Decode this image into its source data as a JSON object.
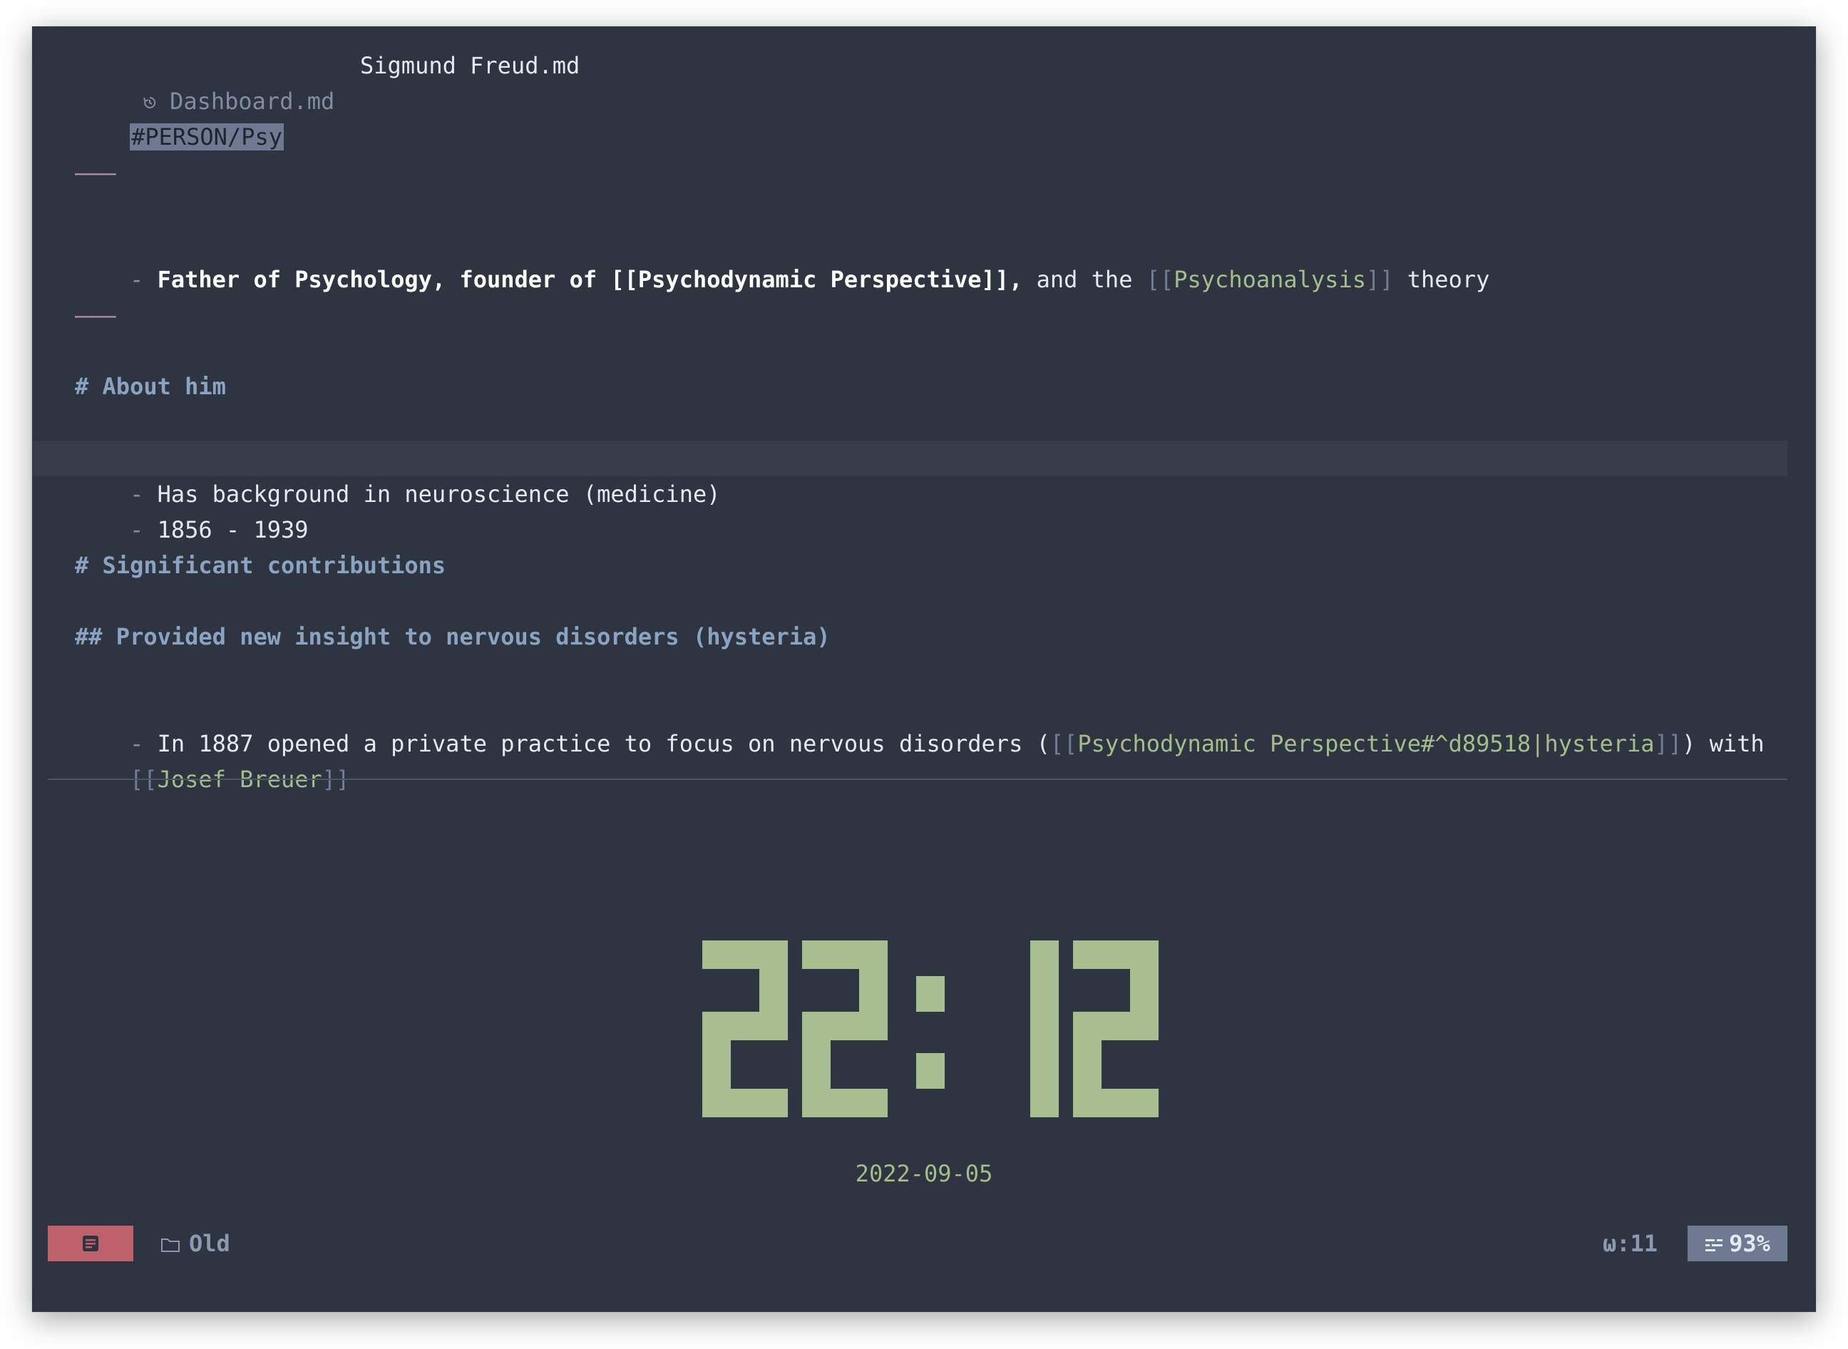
{
  "tabs": [
    {
      "label": "Dashboard.md",
      "icon": "history-icon",
      "active": false
    },
    {
      "label": "Sigmund Freud.md",
      "active": true
    }
  ],
  "note": {
    "tag": "#PERSON/Psy",
    "rule": "———",
    "summary": {
      "bullet": "-",
      "bold_text": "Father of Psychology, founder of [[Psychodynamic Perspective]],",
      "text_1": " and the ",
      "link_open": "[[",
      "link": "Psychoanalysis",
      "link_close": "]]",
      "text_2": " theory"
    },
    "heading_about": "# About him",
    "about_items": [
      "Has background in neuroscience (medicine)",
      "1856 - 1939"
    ],
    "heading_contrib": "# Significant contributions",
    "subheading": "## Provided new insight to nervous disorders (hysteria)",
    "contrib_line": {
      "bullet": "-",
      "text_1": " In 1887 opened a private practice to focus on nervous disorders (",
      "link1_open": "[[",
      "link1": "Psychodynamic Perspective#^d89518|hysteria",
      "link1_close": "]]",
      "text_2": ") with",
      "link2_open": "[[",
      "link2": "Josef Breuer",
      "link2_close": "]]"
    }
  },
  "clock": {
    "time": "22:12",
    "date": "2022-09-05"
  },
  "statusbar": {
    "mode_icon": "document-icon",
    "folder_icon": "folder-icon",
    "folder": "Old",
    "words": "ω:11",
    "percent_icon": "scroll-icon",
    "percent": "93%"
  },
  "colors": {
    "background": "#2e3440",
    "accent_green": "#a3be8c",
    "heading": "#8aa3c1",
    "mode_red": "#bf616a",
    "badge": "#6d7a92"
  }
}
